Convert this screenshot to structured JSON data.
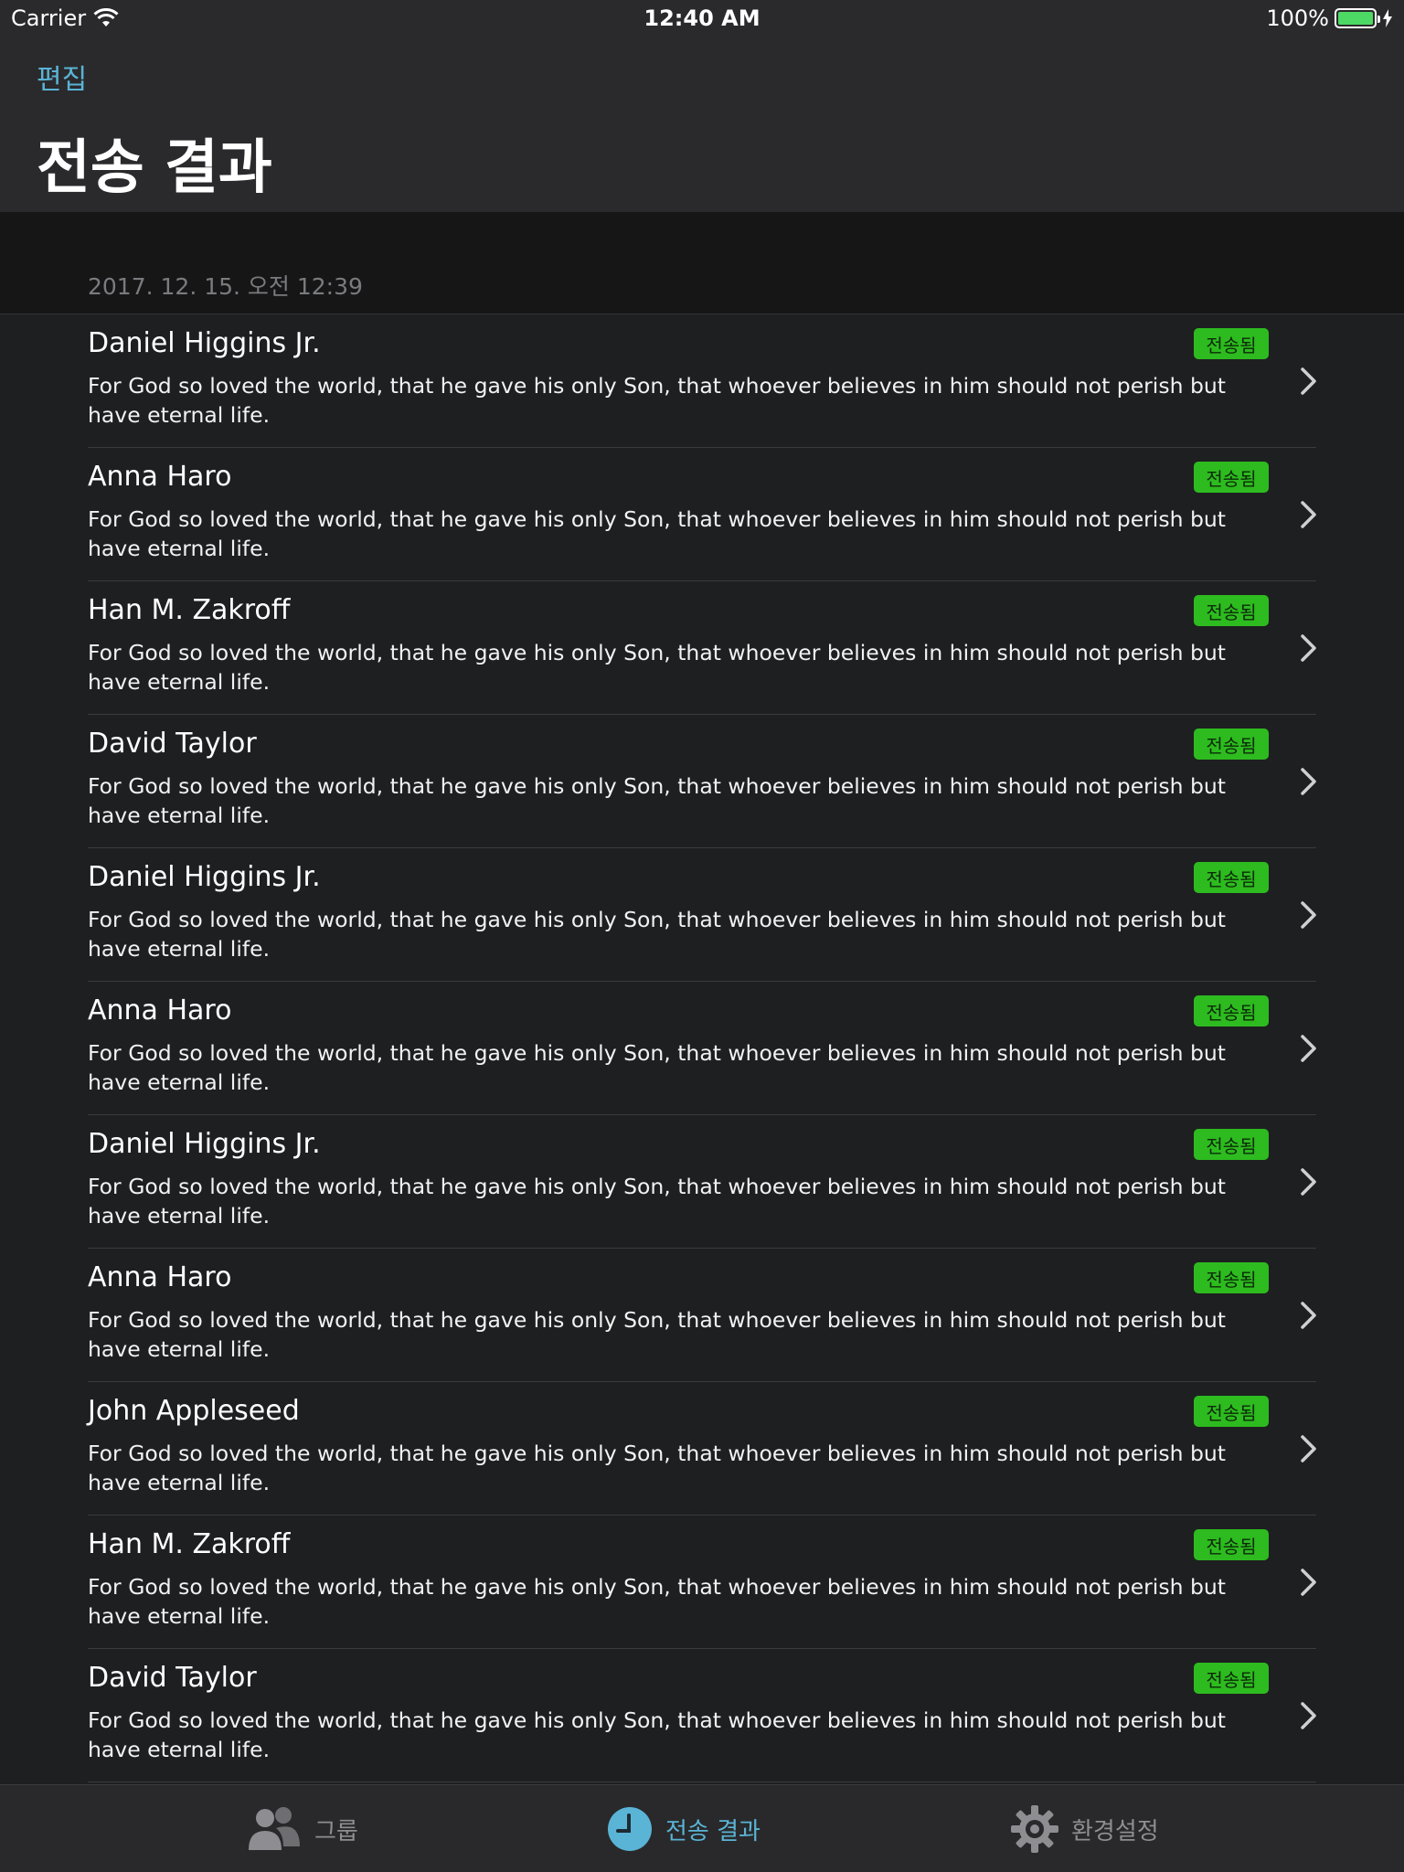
{
  "status_bar": {
    "carrier": "Carrier",
    "time": "12:40 AM",
    "battery": "100%",
    "battery_level": 1.0
  },
  "nav": {
    "edit_label": "편집",
    "title": "전송 결과"
  },
  "section": {
    "date": "2017. 12. 15. 오전 12:39"
  },
  "rows": [
    {
      "name": "Daniel Higgins Jr.",
      "badge": "전송됨",
      "message": "For God so loved the world, that he gave his only Son, that whoever believes in him should not perish but have eternal life."
    },
    {
      "name": "Anna Haro",
      "badge": "전송됨",
      "message": "For God so loved the world, that he gave his only Son, that whoever believes in him should not perish but have eternal life."
    },
    {
      "name": "Han M. Zakroff",
      "badge": "전송됨",
      "message": "For God so loved the world, that he gave his only Son, that whoever believes in him should not perish but have eternal life."
    },
    {
      "name": "David Taylor",
      "badge": "전송됨",
      "message": "For God so loved the world, that he gave his only Son, that whoever believes in him should not perish but have eternal life."
    },
    {
      "name": "Daniel Higgins Jr.",
      "badge": "전송됨",
      "message": "For God so loved the world, that he gave his only Son, that whoever believes in him should not perish but have eternal life."
    },
    {
      "name": "Anna Haro",
      "badge": "전송됨",
      "message": "For God so loved the world, that he gave his only Son, that whoever believes in him should not perish but have eternal life."
    },
    {
      "name": "Daniel Higgins Jr.",
      "badge": "전송됨",
      "message": "For God so loved the world, that he gave his only Son, that whoever believes in him should not perish but have eternal life."
    },
    {
      "name": "Anna Haro",
      "badge": "전송됨",
      "message": "For God so loved the world, that he gave his only Son, that whoever believes in him should not perish but have eternal life."
    },
    {
      "name": "John Appleseed",
      "badge": "전송됨",
      "message": "For God so loved the world, that he gave his only Son, that whoever believes in him should not perish but have eternal life."
    },
    {
      "name": "Han M. Zakroff",
      "badge": "전송됨",
      "message": "For God so loved the world, that he gave his only Son, that whoever believes in him should not perish but have eternal life."
    },
    {
      "name": "David Taylor",
      "badge": "전송됨",
      "message": "For God so loved the world, that he gave his only Son, that whoever believes in him should not perish but have eternal life."
    }
  ],
  "tabs": [
    {
      "label": "그룹",
      "icon": "group-icon",
      "active": false
    },
    {
      "label": "전송 결과",
      "icon": "clock-icon",
      "active": true
    },
    {
      "label": "환경설정",
      "icon": "gear-icon",
      "active": false
    }
  ],
  "colors": {
    "accent": "#5ab4d6",
    "badge": "#2dbb1f",
    "background": "#1e1f21",
    "header": "#2a2a2c",
    "battery": "#4cd964"
  }
}
